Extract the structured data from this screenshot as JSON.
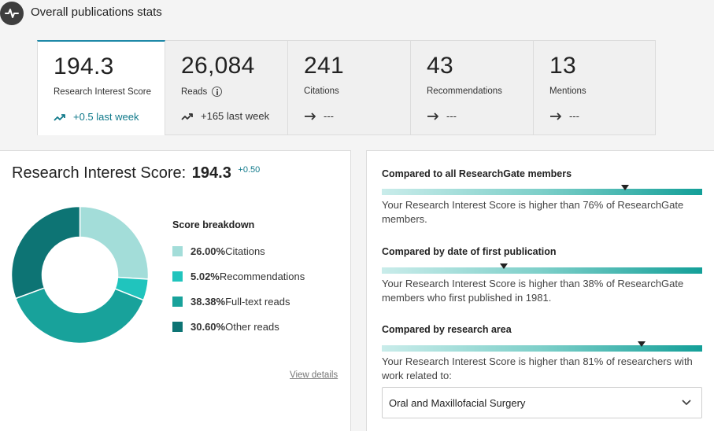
{
  "header": {
    "title": "Overall publications stats",
    "icon": "activity-icon"
  },
  "stats": [
    {
      "value": "194.3",
      "label": "Research Interest Score",
      "trend": "+0.5 last week",
      "trend_icon": "trending-up-icon",
      "active": true
    },
    {
      "value": "26,084",
      "label": "Reads",
      "trend": "+165 last week",
      "trend_icon": "trending-up-icon",
      "info_icon": "info-icon"
    },
    {
      "value": "241",
      "label": "Citations",
      "trend": "---",
      "trend_icon": "arrow-right-icon"
    },
    {
      "value": "43",
      "label": "Recommendations",
      "trend": "---",
      "trend_icon": "arrow-right-icon"
    },
    {
      "value": "13",
      "label": "Mentions",
      "trend": "---",
      "trend_icon": "arrow-right-icon"
    }
  ],
  "ris": {
    "title": "Research Interest Score:",
    "value": "194.3",
    "delta": "+0.50"
  },
  "breakdown": {
    "title": "Score breakdown",
    "items": [
      {
        "pct": "26.00%",
        "label": " Citations",
        "value": 26.0,
        "color": "#a3ddd9"
      },
      {
        "pct": "5.02%",
        "label": " Recommendations",
        "value": 5.02,
        "color": "#20c4bd"
      },
      {
        "pct": "38.38%",
        "label": " Full-text reads",
        "value": 38.38,
        "color": "#18a29b"
      },
      {
        "pct": "30.60%",
        "label": " Other reads",
        "value": 30.6,
        "color": "#0d7474"
      }
    ],
    "view_details": "View details"
  },
  "comparisons": [
    {
      "title": "Compared to all ResearchGate members",
      "text": "Your Research Interest Score is higher than 76% of ResearchGate members.",
      "percentile": 76
    },
    {
      "title": "Compared by date of first publication",
      "text": "Your Research Interest Score is higher than 38% of ResearchGate members who first published in 1981.",
      "percentile": 38
    },
    {
      "title": "Compared by research area",
      "text": "Your Research Interest Score is higher than 81% of researchers with work related to:",
      "percentile": 81
    }
  ],
  "research_area": {
    "selected": "Oral and Maxillofacial Surgery",
    "icon": "chevron-down-icon"
  }
}
